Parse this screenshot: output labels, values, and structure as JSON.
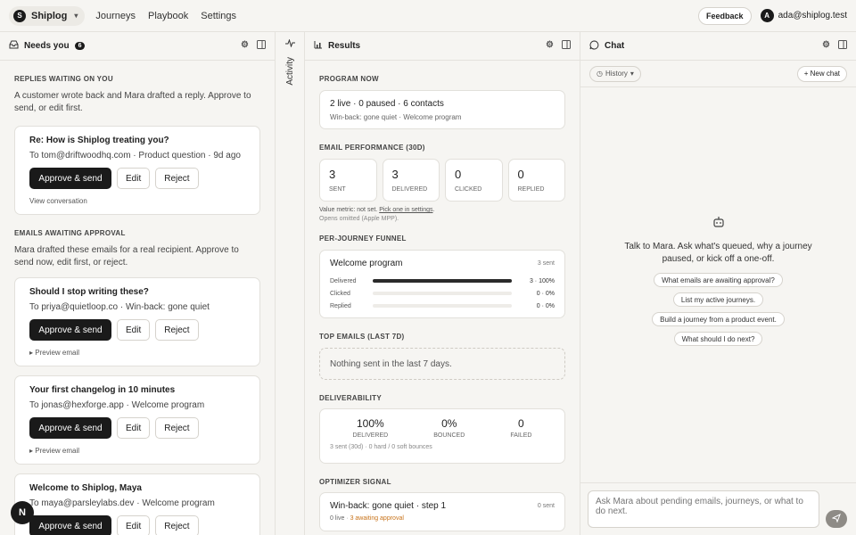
{
  "topbar": {
    "brand_initial": "S",
    "brand": "Shiplog",
    "nav": [
      "Journeys",
      "Playbook",
      "Settings"
    ],
    "feedback": "Feedback",
    "account_initial": "A",
    "account_email": "ada@shiplog.test"
  },
  "needs": {
    "title": "Needs you",
    "count": "6",
    "replies_title": "REPLIES WAITING ON YOU",
    "replies_desc": "A customer wrote back and Mara drafted a reply. Approve to send, or edit first.",
    "reply_card": {
      "subject": "Re: How is Shiplog treating you?",
      "meta": "To tom@driftwoodhq.com · Product question · 9d ago",
      "approve": "Approve & send",
      "edit": "Edit",
      "reject": "Reject",
      "link": "View conversation"
    },
    "emails_title": "EMAILS AWAITING APPROVAL",
    "emails_desc": "Mara drafted these emails for a real recipient. Approve to send now, edit first, or reject.",
    "emails": [
      {
        "subject": "Should I stop writing these?",
        "meta": "To priya@quietloop.co · Win-back: gone quiet",
        "approve": "Approve & send",
        "edit": "Edit",
        "reject": "Reject",
        "link": "Preview email"
      },
      {
        "subject": "Your first changelog in 10 minutes",
        "meta": "To jonas@hexforge.app · Welcome program",
        "approve": "Approve & send",
        "edit": "Edit",
        "reject": "Reject",
        "link": "Preview email"
      },
      {
        "subject": "Welcome to Shiplog, Maya",
        "meta": "To maya@parsleylabs.dev · Welcome program",
        "approve": "Approve & send",
        "edit": "Edit",
        "reject": "Reject",
        "link": ""
      }
    ],
    "fab_initial": "N"
  },
  "activity": {
    "label": "Activity"
  },
  "results": {
    "title": "Results",
    "program_now_title": "PROGRAM NOW",
    "program_summary": "2 live · 0 paused · 6 contacts",
    "program_journeys": "Win-back: gone quiet · Welcome program",
    "email_perf_title": "EMAIL PERFORMANCE (30D)",
    "stats": [
      {
        "value": "3",
        "label": "SENT"
      },
      {
        "value": "3",
        "label": "DELIVERED"
      },
      {
        "value": "0",
        "label": "CLICKED"
      },
      {
        "value": "0",
        "label": "REPLIED"
      }
    ],
    "value_metric_prefix": "Value metric: not set.",
    "value_metric_link": "Pick one in settings",
    "value_metric_suffix": ".",
    "opens_note": "Opens omitted (Apple MPP).",
    "funnel_title": "PER-JOURNEY FUNNEL",
    "funnel": {
      "name": "Welcome program",
      "sent": "3 sent",
      "rows": [
        {
          "label": "Delivered",
          "value": "3 · 100%",
          "fraction": 1.0
        },
        {
          "label": "Clicked",
          "value": "0 · 0%",
          "fraction": 0.0
        },
        {
          "label": "Replied",
          "value": "0 · 0%",
          "fraction": 0.0
        }
      ]
    },
    "top_emails_title": "TOP EMAILS (LAST 7D)",
    "top_emails_empty": "Nothing sent in the last 7 days.",
    "deliverability_title": "DELIVERABILITY",
    "deliverability": [
      {
        "value": "100%",
        "label": "DELIVERED"
      },
      {
        "value": "0%",
        "label": "BOUNCED"
      },
      {
        "value": "0",
        "label": "FAILED"
      }
    ],
    "deliverability_note": "3 sent (30d) · 0 hard / 0 soft bounces",
    "optimizer_title": "OPTIMIZER SIGNAL",
    "optimizer": {
      "name": "Win-back: gone quiet · step 1",
      "sent": "0 sent",
      "live": "0 live",
      "awaiting": "3 awaiting approval"
    }
  },
  "chat": {
    "title": "Chat",
    "history": "History",
    "new_chat": "+ New chat",
    "intro": "Talk to Mara. Ask what's queued, why a journey paused, or kick off a one-off.",
    "suggestions": [
      "What emails are awaiting approval?",
      "List my active journeys.",
      "Build a journey from a product event.",
      "What should I do next?"
    ],
    "input_placeholder": "Ask Mara about pending emails, journeys, or what to do next."
  },
  "colors": {
    "accent": "#1a1a1a",
    "warning": "#c8731a",
    "panel_bg": "#f6f5f2"
  }
}
